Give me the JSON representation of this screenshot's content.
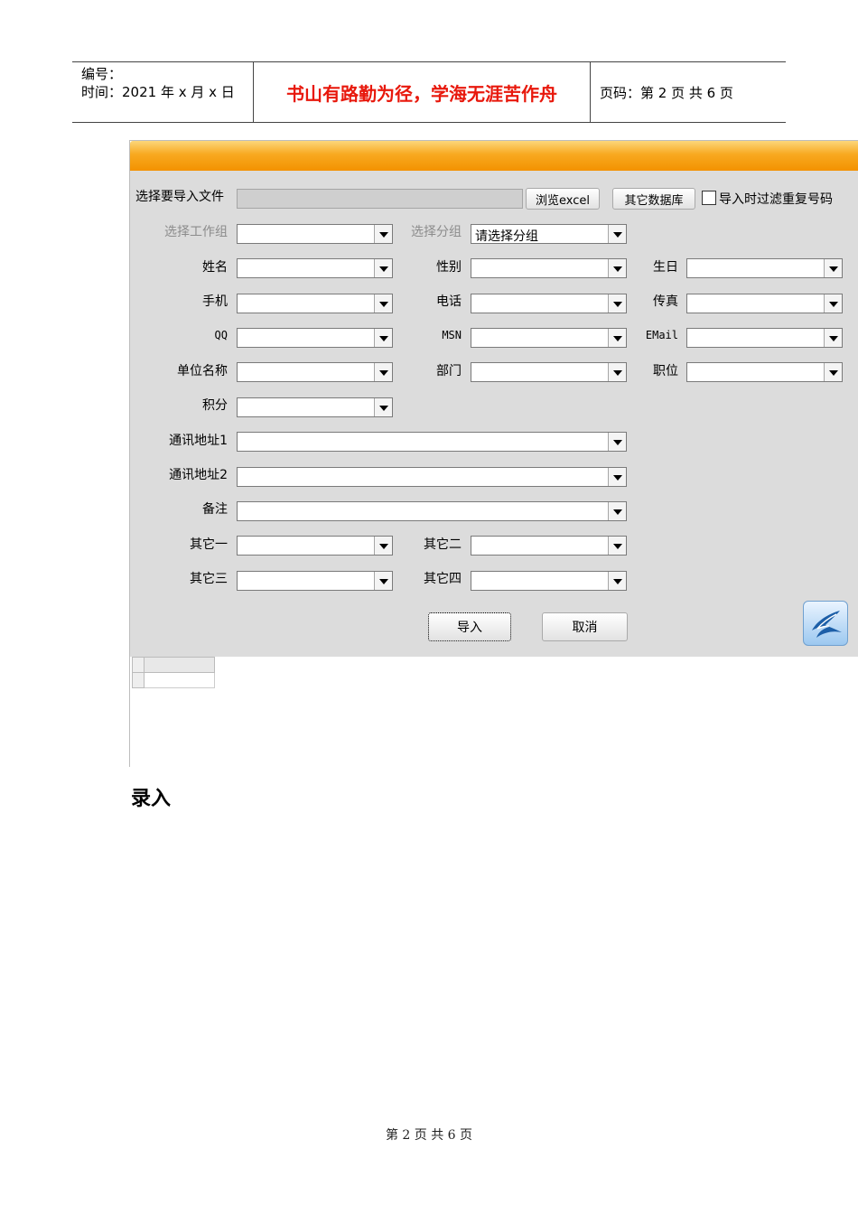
{
  "header": {
    "number_label": "编号：",
    "time_label": "时间：2021 年 x 月 x 日",
    "motto": "书山有路勤为径，学海无涯苦作舟",
    "page_label": "页码：第 2 页  共 6 页"
  },
  "form": {
    "file_label": "选择要导入文件",
    "browse_button": "浏览excel",
    "other_db_button": "其它数据库",
    "filter_label": "导入时过滤重复号码",
    "filter_checked": false,
    "workgroup_label": "选择工作组",
    "group_label": "选择分组",
    "group_value": "请选择分组",
    "fields": {
      "name": "姓名",
      "gender": "性别",
      "birthday": "生日",
      "mobile": "手机",
      "phone": "电话",
      "fax": "传真",
      "qq": "QQ",
      "msn": "MSN",
      "email": "EMail",
      "company": "单位名称",
      "department": "部门",
      "position": "职位",
      "points": "积分",
      "address1": "通讯地址1",
      "address2": "通讯地址2",
      "remark": "备注",
      "other1": "其它一",
      "other2": "其它二",
      "other3": "其它三",
      "other4": "其它四"
    },
    "import_button": "导入",
    "cancel_button": "取消"
  },
  "section_heading": "录入",
  "footer": "第 2 页 共 6 页",
  "colors": {
    "titlebar": "#f39200",
    "motto": "#e8180c",
    "form_bg": "#dcdcdc"
  }
}
